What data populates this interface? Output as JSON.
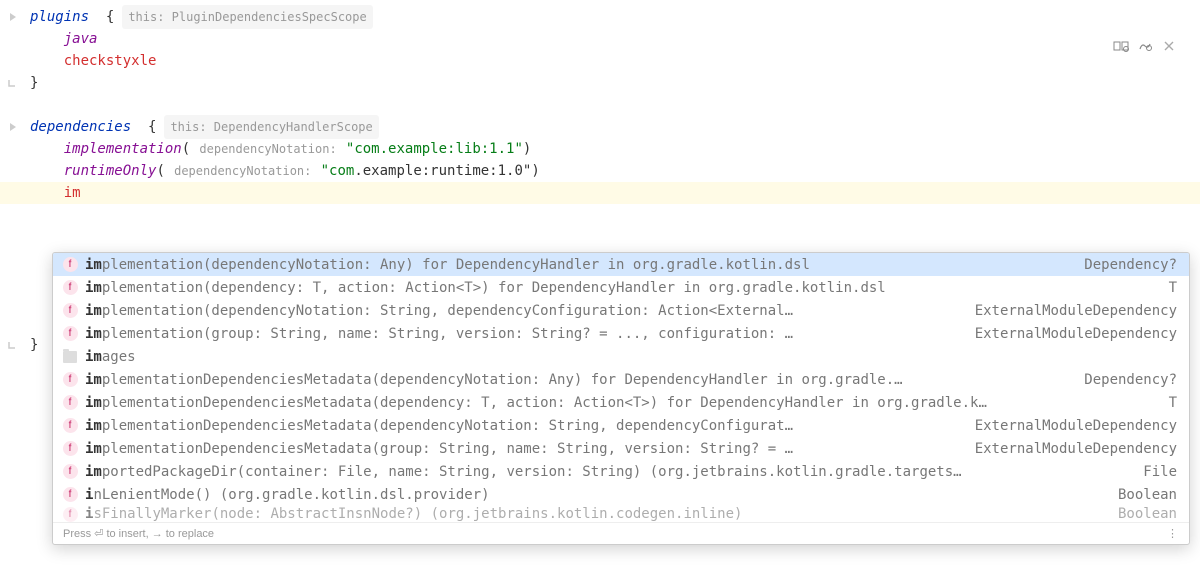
{
  "code": {
    "plugins_kw": "plugins",
    "brace_o": "  {",
    "brace_c": "}",
    "hint_plugins": "this: PluginDependenciesSpecScope",
    "java": "java",
    "checkstyxle": "checkstyxle",
    "deps_kw": "dependencies",
    "hint_deps": "this: DependencyHandlerScope",
    "impl": "implementation",
    "runtime": "runtimeOnly",
    "paren_o": "(",
    "paren_c": ")",
    "depnot": " dependencyNotation: ",
    "str1": "\"com.example:lib:1.1\"",
    "str2a": "\"com",
    "str2b": ".example:runtime:1.0\"",
    "typed": "im"
  },
  "popup": {
    "items": [
      {
        "icon": "f",
        "sel": true,
        "bold": "im",
        "rest": "plementation(dependencyNotation: Any) for DependencyHandler in org.gradle.kotlin.dsl",
        "ret": "Dependency?"
      },
      {
        "icon": "f",
        "sel": false,
        "bold": "im",
        "rest": "plementation(dependency: T, action: Action<T>) for DependencyHandler in org.gradle.kotlin.dsl",
        "ret": "T"
      },
      {
        "icon": "f",
        "sel": false,
        "bold": "im",
        "rest": "plementation(dependencyNotation: String, dependencyConfiguration: Action<External…",
        "ret": "ExternalModuleDependency"
      },
      {
        "icon": "f",
        "sel": false,
        "bold": "im",
        "rest": "plementation(group: String, name: String, version: String? = ..., configuration: …",
        "ret": "ExternalModuleDependency"
      },
      {
        "icon": "d",
        "sel": false,
        "bold": "im",
        "rest": "ages",
        "ret": ""
      },
      {
        "icon": "f",
        "sel": false,
        "bold": "im",
        "rest": "plementationDependenciesMetadata(dependencyNotation: Any) for DependencyHandler in org.gradle.…",
        "ret": "Dependency?"
      },
      {
        "icon": "f",
        "sel": false,
        "bold": "im",
        "rest": "plementationDependenciesMetadata(dependency: T, action: Action<T>) for DependencyHandler in org.gradle.k…",
        "ret": "T"
      },
      {
        "icon": "f",
        "sel": false,
        "bold": "im",
        "rest": "plementationDependenciesMetadata(dependencyNotation: String, dependencyConfigurat…",
        "ret": "ExternalModuleDependency"
      },
      {
        "icon": "f",
        "sel": false,
        "bold": "im",
        "rest": "plementationDependenciesMetadata(group: String, name: String, version: String? = …",
        "ret": "ExternalModuleDependency"
      },
      {
        "icon": "f",
        "sel": false,
        "bold": "im",
        "rest": "portedPackageDir(container: File, name: String, version: String) (org.jetbrains.kotlin.gradle.targets…",
        "ret": "File"
      },
      {
        "icon": "f",
        "sel": false,
        "bold": "i",
        "rest": "nLenientMode() (org.gradle.kotlin.dsl.provider)",
        "ret": "Boolean"
      },
      {
        "icon": "f",
        "sel": false,
        "bold": "i",
        "rest": "sFinallyMarker(node: AbstractInsnNode?) (org.jetbrains.kotlin.codegen.inline)",
        "ret": "Boolean",
        "cut": true
      }
    ],
    "footer": "Press ⏎ to insert, → to replace",
    "more": "⋮"
  }
}
